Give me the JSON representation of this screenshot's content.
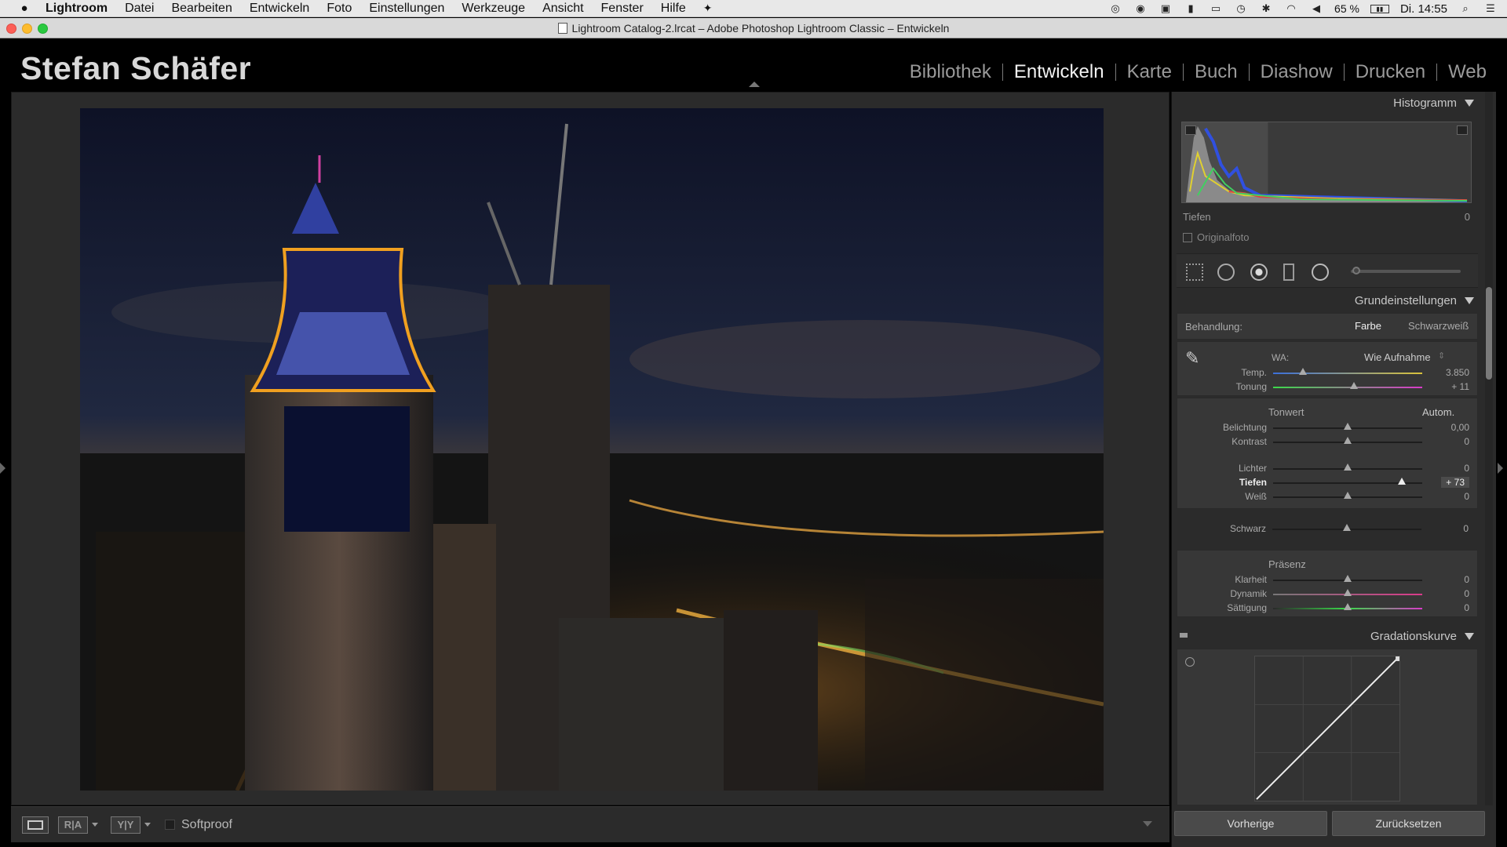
{
  "menubar": {
    "apple": "",
    "app": "Lightroom",
    "items": [
      "Datei",
      "Bearbeiten",
      "Entwickeln",
      "Foto",
      "Einstellungen",
      "Werkzeuge",
      "Ansicht",
      "Fenster",
      "Hilfe"
    ],
    "battery": "65 %",
    "clock": "Di. 14:55"
  },
  "titlebar": {
    "title": "Lightroom Catalog-2.lrcat – Adobe Photoshop Lightroom Classic – Entwickeln"
  },
  "identity": "Stefan Schäfer",
  "modules": [
    "Bibliothek",
    "Entwickeln",
    "Karte",
    "Buch",
    "Diashow",
    "Drucken",
    "Web"
  ],
  "active_module": "Entwickeln",
  "toolbar": {
    "ra_label": "R|A",
    "yy_label": "Y|Y",
    "softproof": "Softproof"
  },
  "histogram": {
    "header": "Histogramm",
    "info_label": "Tiefen",
    "info_value": "0",
    "original_label": "Originalfoto"
  },
  "basic": {
    "header": "Grundeinstellungen",
    "treatment_label": "Behandlung:",
    "treatment_color": "Farbe",
    "treatment_bw": "Schwarzweiß",
    "wb_label": "WA:",
    "wb_value": "Wie Aufnahme",
    "temp_label": "Temp.",
    "temp_value": "3.850",
    "temp_pos": 0.2,
    "tint_label": "Tonung",
    "tint_value": "+ 11",
    "tint_pos": 0.54,
    "tone_label": "Tonwert",
    "auto_label": "Autom.",
    "exposure_label": "Belichtung",
    "exposure_value": "0,00",
    "exposure_pos": 0.5,
    "contrast_label": "Kontrast",
    "contrast_value": "0",
    "contrast_pos": 0.5,
    "highlights_label": "Lichter",
    "highlights_value": "0",
    "highlights_pos": 0.5,
    "shadows_label": "Tiefen",
    "shadows_value": "+ 73",
    "shadows_pos": 0.865,
    "whites_label": "Weiß",
    "whites_value": "0",
    "whites_pos": 0.5,
    "blacks_label": "Schwarz",
    "blacks_value": "0",
    "blacks_pos": 0.5,
    "presence_label": "Präsenz",
    "clarity_label": "Klarheit",
    "clarity_value": "0",
    "clarity_pos": 0.5,
    "vibrance_label": "Dynamik",
    "vibrance_value": "0",
    "vibrance_pos": 0.5,
    "saturation_label": "Sättigung",
    "saturation_value": "0",
    "saturation_pos": 0.5
  },
  "curve": {
    "header": "Gradationskurve"
  },
  "buttons": {
    "previous": "Vorherige",
    "reset": "Zurücksetzen"
  },
  "colors": {
    "accent_temp_left": "#3b6fd9",
    "accent_temp_right": "#d9c23b",
    "accent_tint_left": "#3bd94a",
    "accent_tint_right": "#d93bc9"
  }
}
